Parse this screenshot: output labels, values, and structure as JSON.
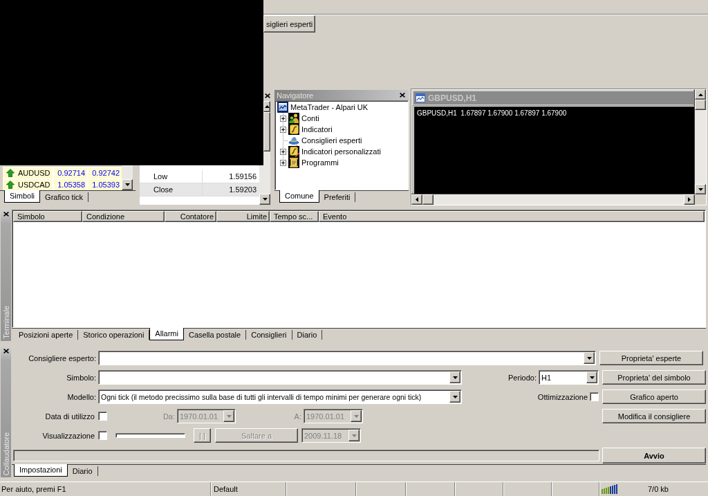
{
  "toolbar": {
    "buttons": [
      {
        "label": "siglieri esperti"
      }
    ]
  },
  "market_watch": {
    "rows": [
      {
        "symbol": "AUDUSD",
        "column_2": "0.92714",
        "column_3": "0.92742"
      },
      {
        "symbol": "USDCAD",
        "column_2": "1.05358",
        "column_3": "1.05393"
      }
    ],
    "tabs": [
      {
        "label": "Simboli",
        "selected": true
      },
      {
        "label": "Grafico tick",
        "selected": false
      }
    ]
  },
  "data_window": {
    "rows": [
      {
        "label": "Low",
        "value": "1.59156",
        "selected": false
      },
      {
        "label": "Close",
        "value": "1.59203",
        "selected": true
      }
    ]
  },
  "navigator": {
    "title": "Navigatore",
    "root": {
      "label": "MetaTrader - Alpari UK",
      "expanded": true,
      "children": [
        {
          "label": "Conti",
          "kind": "accounts",
          "expandable": true,
          "expanded": false
        },
        {
          "label": "Indicatori",
          "kind": "indicators",
          "expandable": true,
          "expanded": false
        },
        {
          "label": "Consiglieri esperti",
          "kind": "experts",
          "expandable": false
        },
        {
          "label": "Indicatori personalizzati",
          "kind": "custom_indicators",
          "expandable": true,
          "expanded": false
        },
        {
          "label": "Programmi",
          "kind": "scripts",
          "expandable": true,
          "expanded": false
        }
      ]
    },
    "tabs": [
      {
        "label": "Comune",
        "selected": true
      },
      {
        "label": "Preferiti",
        "selected": false
      }
    ]
  },
  "chart_window": {
    "title": "GBPUSD,H1",
    "info": "GBPUSD,H1  1.67897 1.67900 1.67897 1.67900"
  },
  "terminal": {
    "label": "Terminale",
    "columns": [
      "Simbolo",
      "Condizione",
      "Contatore",
      "Limite",
      "Tempo sc...",
      "Evento"
    ],
    "tabs": [
      {
        "label": "Posizioni aperte",
        "selected": false
      },
      {
        "label": "Storico operazioni",
        "selected": false
      },
      {
        "label": "Allarmi",
        "selected": true
      },
      {
        "label": "Casella postale",
        "selected": false
      },
      {
        "label": "Consiglieri",
        "selected": false
      },
      {
        "label": "Diario",
        "selected": false
      }
    ]
  },
  "tester": {
    "label": "Collaudatore",
    "expert": {
      "label": "Consigliere esperto:"
    },
    "symbol": {
      "label": "Simbolo:"
    },
    "period": {
      "label": "Periodo:",
      "value": "H1"
    },
    "model": {
      "label": "Modello:",
      "value": "Ogni tick (il metodo precissimo sulla base di tutti gli intervalli di tempo minimi per generare ogni tick)"
    },
    "optimization": {
      "label": "Ottimizzazione",
      "checked": false
    },
    "use_date": {
      "label": "Data di utilizzo",
      "checked": false
    },
    "date_from": {
      "label": "Da:",
      "value": "1970.01.01",
      "disabled": true
    },
    "date_to": {
      "label": "A:",
      "value": "1970.01.01",
      "disabled": true
    },
    "visual_mode": {
      "label": "Visualizzazione",
      "checked": false
    },
    "pause_button": {
      "label": "| |",
      "disabled": true
    },
    "skip_button": {
      "label": "Saltare a",
      "disabled": true
    },
    "skip_date": {
      "value": "2009.11.18",
      "disabled": true
    },
    "progress_bar": {
      "level": 0
    },
    "side_buttons": [
      {
        "label": "Proprieta' esperte"
      },
      {
        "label": "Proprieta' del simbolo"
      },
      {
        "label": "Grafico aperto"
      },
      {
        "label": "Modifica il consigliere"
      }
    ],
    "start_button": {
      "label": "Avvio"
    },
    "tabs": [
      {
        "label": "Impostazioni",
        "selected": true
      },
      {
        "label": "Diario",
        "selected": false
      }
    ]
  },
  "status_bar": {
    "help": "Per aiuto, premi F1",
    "profile": "Default",
    "traffic": "7/0 kb"
  }
}
